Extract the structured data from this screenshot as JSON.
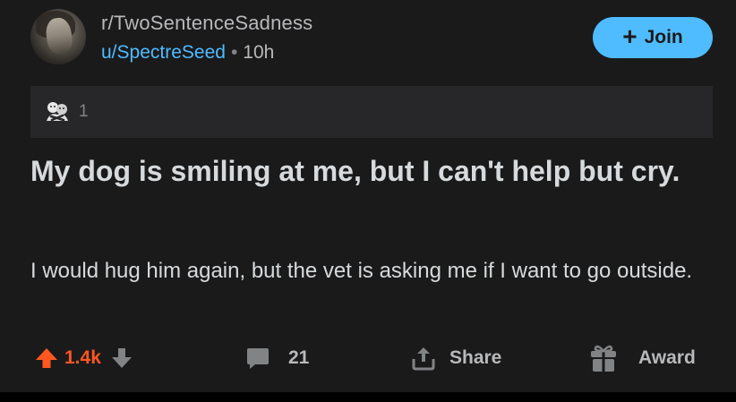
{
  "header": {
    "subreddit": "r/TwoSentenceSadness",
    "username": "u/SpectreSeed",
    "separator": "•",
    "time_ago": "10h",
    "join_label": "Join",
    "join_plus": "+"
  },
  "awards": {
    "count": "1",
    "icon": "wholesome-hug-icon"
  },
  "post": {
    "title": "My dog is smiling at me, but I can't help but cry.",
    "body": "I would hug him again, but the vet is asking me if I want to go outside."
  },
  "actions": {
    "score": "1.4k",
    "comment_count": "21",
    "share_label": "Share",
    "award_label": "Award"
  },
  "colors": {
    "background": "#1a1a1b",
    "accent_blue": "#4fbcff",
    "upvote_orange": "#ff5722",
    "muted_text": "#b8b9bb"
  }
}
